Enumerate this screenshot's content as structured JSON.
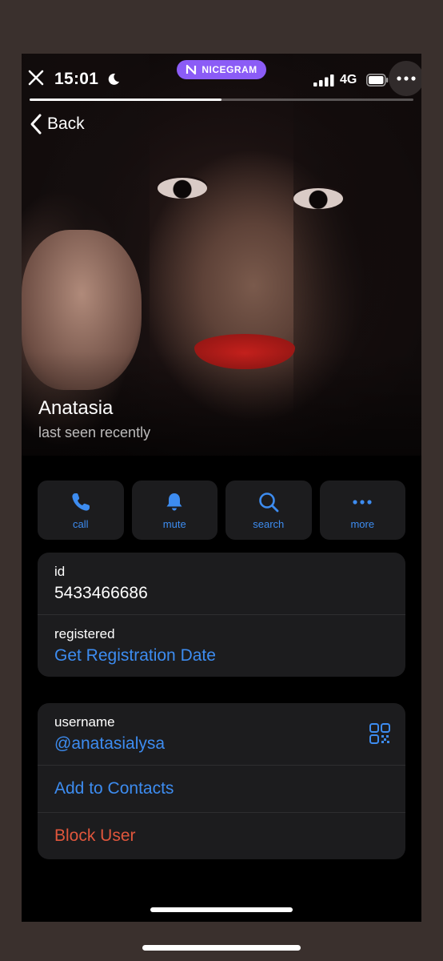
{
  "status": {
    "time": "15:01",
    "network": "4G",
    "badge": "NICEGRAM"
  },
  "story_progress": 0.5,
  "nav": {
    "back_label": "Back"
  },
  "profile": {
    "name": "Anatasia",
    "status": "last seen recently"
  },
  "actions": [
    {
      "label": "call",
      "icon": "phone-icon"
    },
    {
      "label": "mute",
      "icon": "bell-icon"
    },
    {
      "label": "search",
      "icon": "search-icon"
    },
    {
      "label": "more",
      "icon": "ellipsis-icon"
    }
  ],
  "info": {
    "id_label": "id",
    "id_value": "5433466686",
    "registered_label": "registered",
    "registered_value": "Get Registration Date"
  },
  "account": {
    "username_label": "username",
    "username_value": "@anatasialysa",
    "add_contacts": "Add to Contacts",
    "block_user": "Block User"
  },
  "colors": {
    "accent": "#3d8cf0",
    "danger": "#e0563c",
    "badge": "#8b5cf6"
  }
}
